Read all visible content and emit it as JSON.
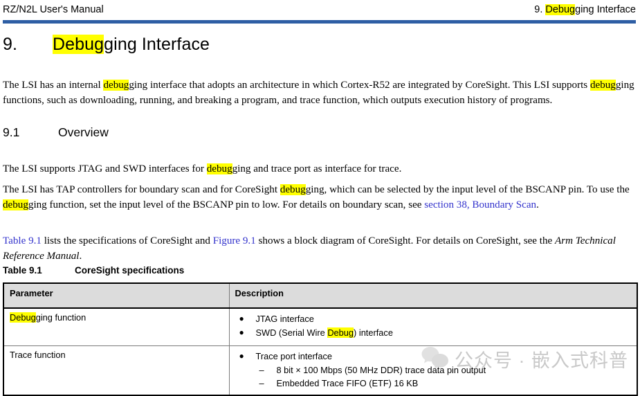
{
  "header": {
    "left_text": "RZ/N2L User's Manual",
    "right_prefix": "9. ",
    "right_highlight": "Debug",
    "right_suffix": "ging Interface",
    "rule_color": "#2e5ea4"
  },
  "title": {
    "number": "9.",
    "highlight": "Debug",
    "rest": "ging Interface"
  },
  "intro": {
    "seg1": "The LSI has an internal ",
    "hl1": "debug",
    "seg2": "ging interface that adopts an architecture in which Cortex-R52 are integrated by CoreSight. This LSI supports ",
    "hl2": "debug",
    "seg3": "ging functions, such as downloading, running, and breaking a program, and trace function, which outputs execution history of programs."
  },
  "section_overview": {
    "number": "9.1",
    "title": "Overview",
    "p1_seg1": "The LSI supports JTAG and SWD interfaces for ",
    "p1_hl": "debug",
    "p1_seg2": "ging and trace port as interface for trace.",
    "p2_seg1": "The LSI has TAP controllers for boundary scan and for CoreSight ",
    "p2_hl1": "debug",
    "p2_seg2": "ging, which can be selected by the input level of the BSCANP pin. To use the ",
    "p2_hl2": "debug",
    "p2_seg3": "ging function, set the input level of the BSCANP pin to low. For details on boundary scan, see ",
    "p2_link": "section 38, Boundary Scan",
    "p2_seg4": ".",
    "p3_link1": "Table 9.1",
    "p3_seg1": " lists the specifications of CoreSight and ",
    "p3_link2": "Figure 9.1",
    "p3_seg2": " shows a block diagram of CoreSight. For details on CoreSight, see the ",
    "p3_italic": "Arm Technical Reference Manual",
    "p3_seg3": "."
  },
  "table": {
    "caption_number": "Table 9.1",
    "caption_title": "CoreSight specifications",
    "columns": [
      "Parameter",
      "Description"
    ],
    "rows": [
      {
        "parameter_hl": "Debug",
        "parameter_rest": "ging function",
        "bullets": [
          {
            "text": "JTAG interface"
          },
          {
            "pre": "SWD (Serial Wire ",
            "hl": "Debug",
            "post": ") interface"
          }
        ]
      },
      {
        "parameter_hl": "",
        "parameter_rest": "Trace function",
        "bullets": [
          {
            "text": "Trace port interface",
            "subitems": [
              "8 bit × 100 Mbps (50 MHz DDR) trace data pin output",
              "Embedded Trace FIFO (ETF) 16 KB"
            ]
          }
        ]
      }
    ],
    "bullet_glyph": "●",
    "dash_glyph": "–",
    "header_bg": "#dcdcdc"
  },
  "watermark": {
    "text": "公众号 · 嵌入式科普",
    "color": "#c9c9c9"
  },
  "colors": {
    "highlight": "#ffff00",
    "link": "#3333cc",
    "rule": "#2e5ea4"
  }
}
